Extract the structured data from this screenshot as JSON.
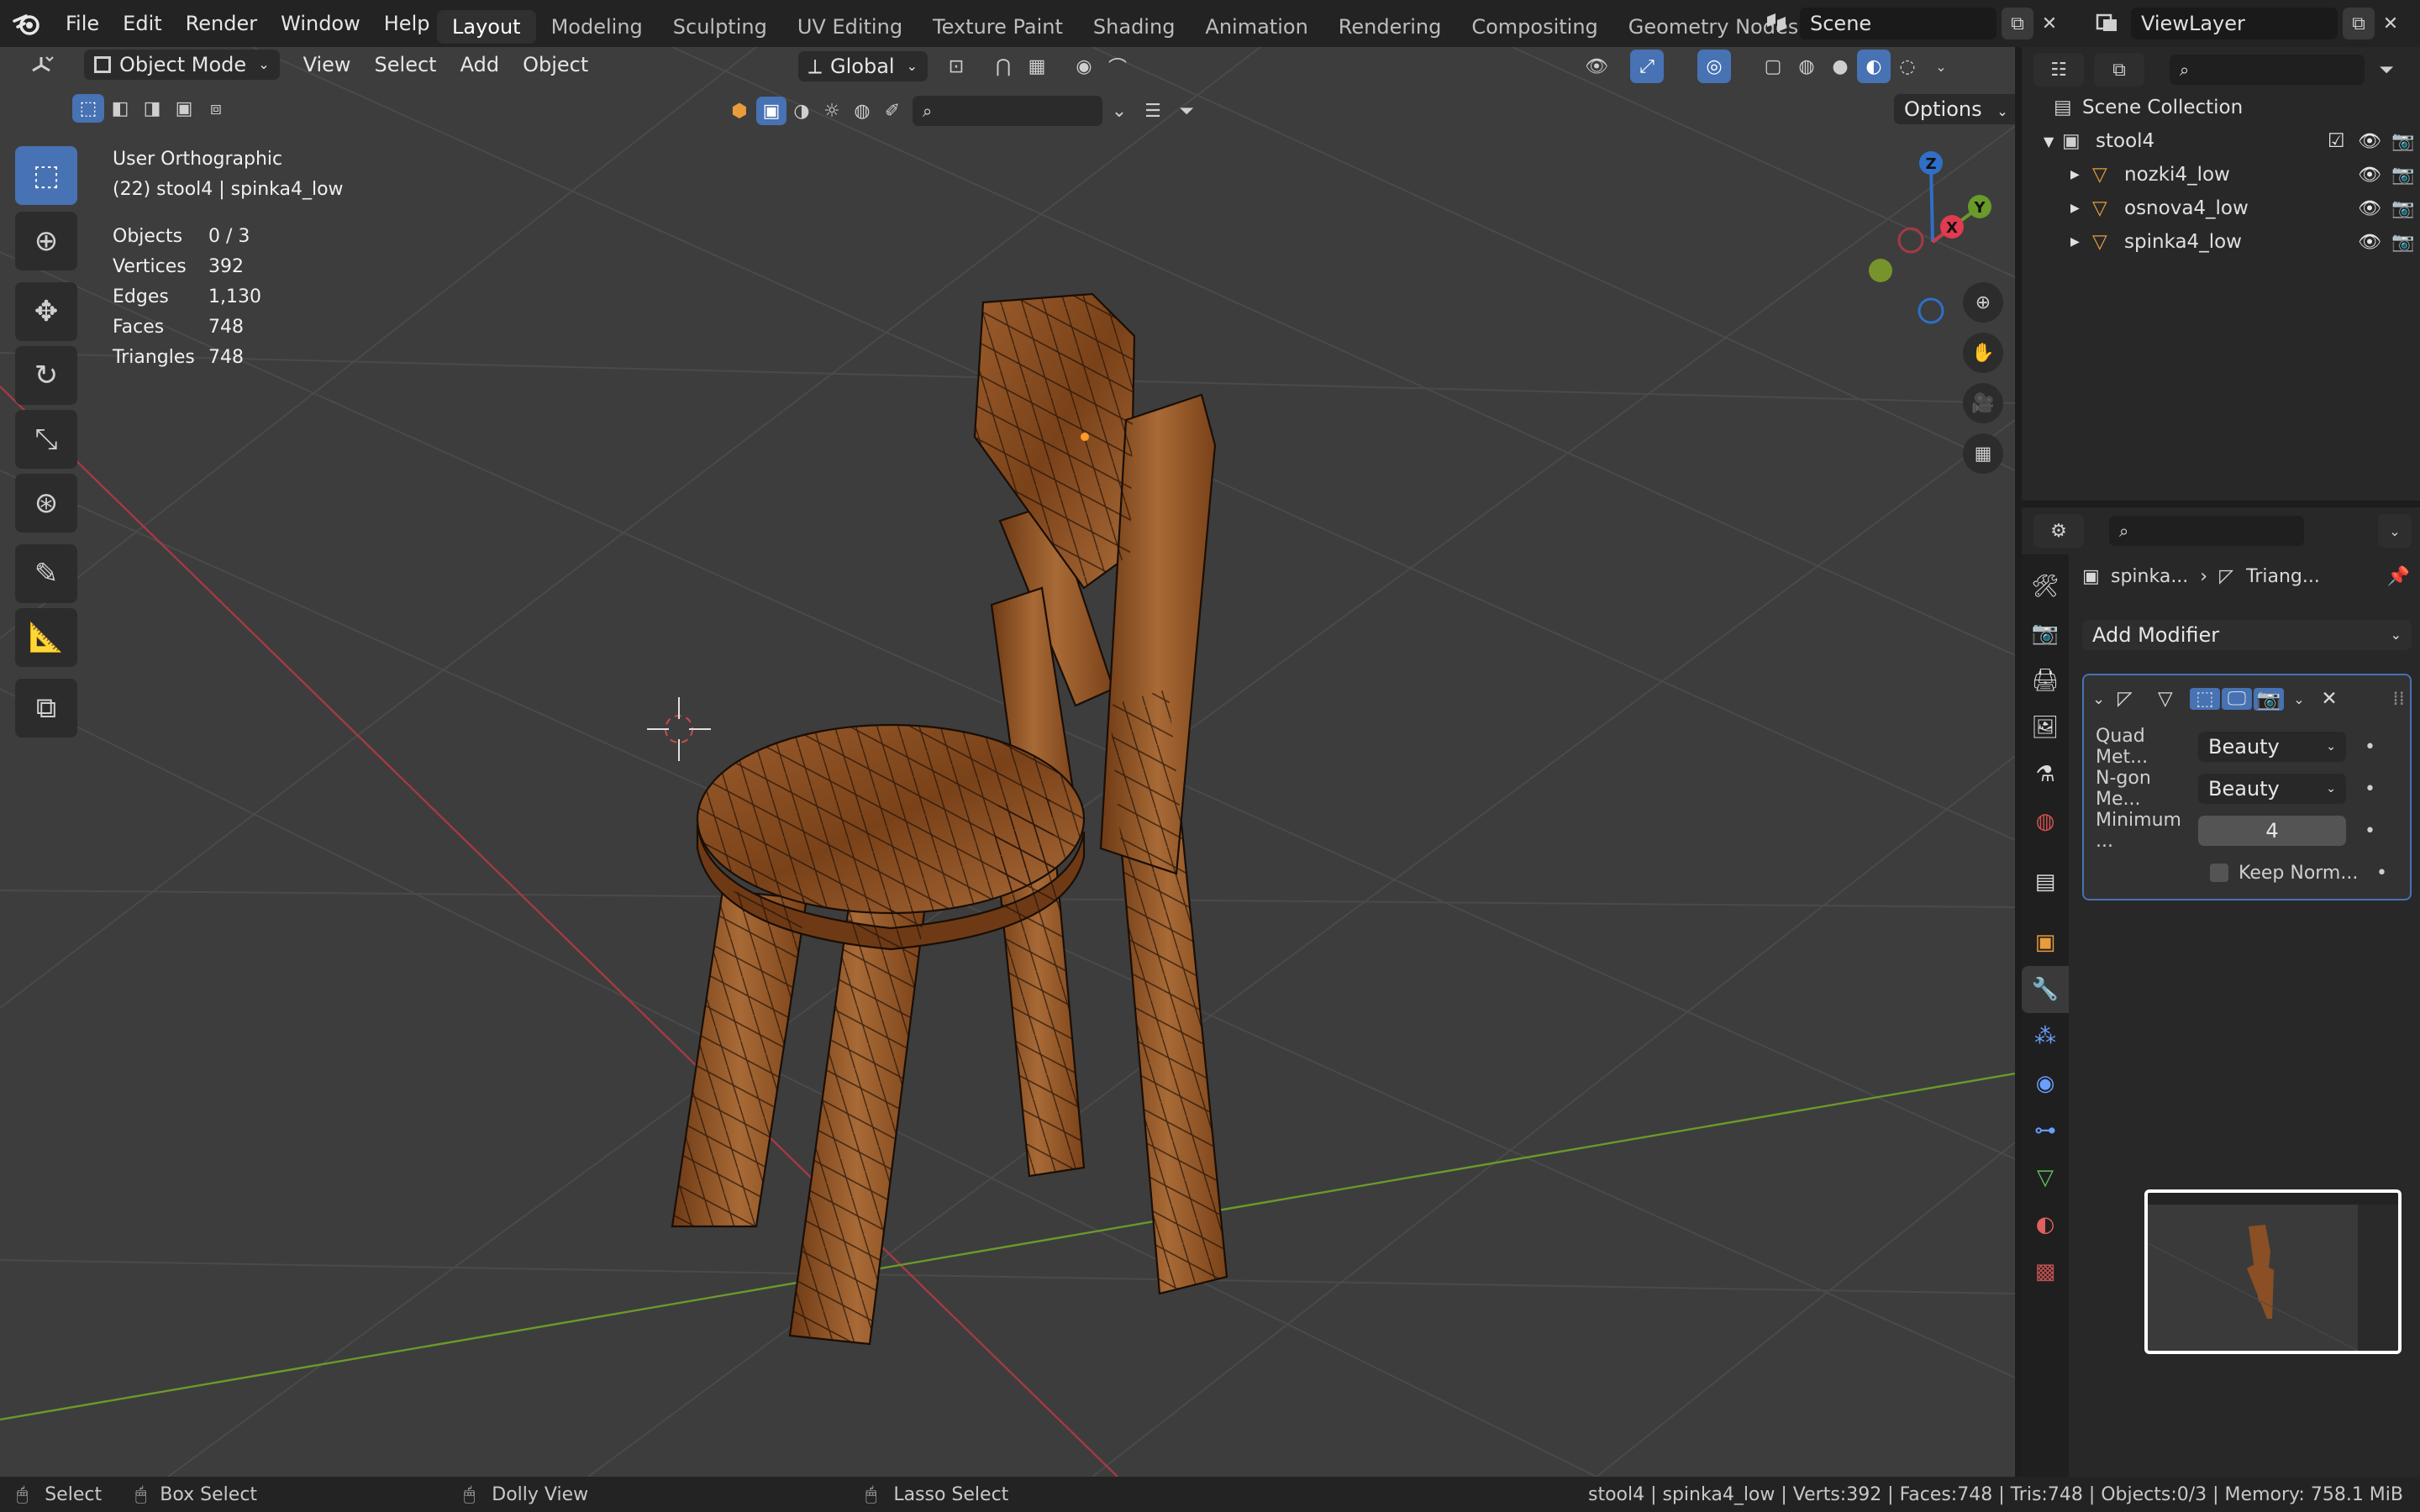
{
  "topbar": {
    "menus": [
      "File",
      "Edit",
      "Render",
      "Window",
      "Help"
    ],
    "workspaces": [
      "Layout",
      "Modeling",
      "Sculpting",
      "UV Editing",
      "Texture Paint",
      "Shading",
      "Animation",
      "Rendering",
      "Compositing",
      "Geometry Nodes"
    ],
    "active_workspace": "Layout",
    "scene_name": "Scene",
    "view_layer_name": "ViewLayer"
  },
  "viewport": {
    "mode": "Object Mode",
    "menus": [
      "View",
      "Select",
      "Add",
      "Object"
    ],
    "transform_orientation": "Global",
    "options_label": "Options",
    "view_name": "User Orthographic",
    "active_info": "(22) stool4 | spinka4_low",
    "stats": [
      {
        "label": "Objects",
        "value": "0 / 3"
      },
      {
        "label": "Vertices",
        "value": "392"
      },
      {
        "label": "Edges",
        "value": "1,130"
      },
      {
        "label": "Faces",
        "value": "748"
      },
      {
        "label": "Triangles",
        "value": "748"
      }
    ],
    "gizmo": {
      "x": "X",
      "y": "Y",
      "z": "Z"
    },
    "colors": {
      "x_axis": "#a33a44",
      "y_axis": "#6a9a2a",
      "accent": "#4772b3",
      "wood": "#8a4f24"
    }
  },
  "outliner": {
    "root": "Scene Collection",
    "collection": "stool4",
    "objects": [
      "nozki4_low",
      "osnova4_low",
      "spinka4_low"
    ]
  },
  "properties": {
    "breadcrumb_object": "spinka...",
    "breadcrumb_modifier": "Triang...",
    "add_modifier": "Add Modifier",
    "fields": [
      {
        "label": "Quad Met...",
        "value": "Beauty"
      },
      {
        "label": "N-gon Me...",
        "value": "Beauty"
      },
      {
        "label": "Minimum ...",
        "value": "4"
      }
    ],
    "checkbox_label": "Keep Norm..."
  },
  "statusbar": {
    "select": "Select",
    "box_select": "Box Select",
    "dolly": "Dolly View",
    "lasso": "Lasso Select",
    "info": "stool4 | spinka4_low | Verts:392 | Faces:748 | Tris:748 | Objects:0/3 | Memory: 758.1 MiB"
  }
}
